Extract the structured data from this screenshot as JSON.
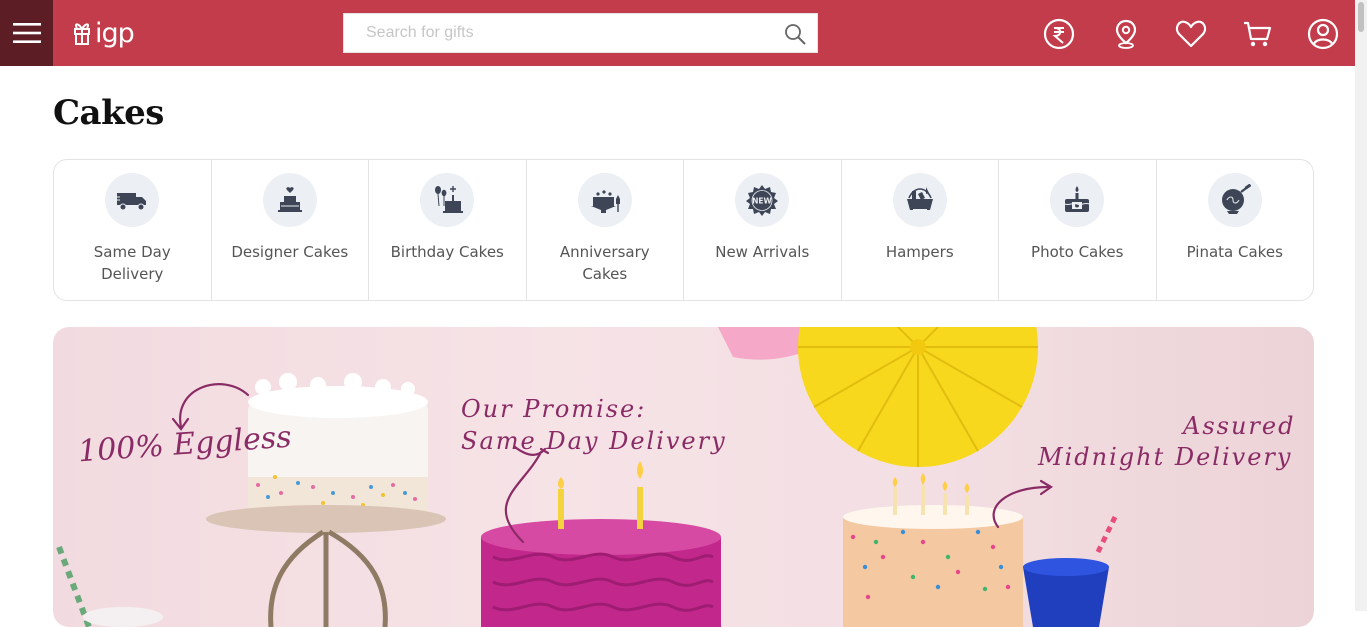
{
  "header": {
    "logo_text": "igp",
    "search_placeholder": "Search for gifts",
    "icons": [
      "rupee-icon",
      "location-icon",
      "heart-icon",
      "cart-icon",
      "user-icon"
    ]
  },
  "page": {
    "title": "Cakes"
  },
  "categories": [
    {
      "label": "Same Day Delivery",
      "icon": "delivery-truck-icon"
    },
    {
      "label": "Designer Cakes",
      "icon": "designer-cake-icon"
    },
    {
      "label": "Birthday Cakes",
      "icon": "birthday-cake-icon"
    },
    {
      "label": "Anniversary Cakes",
      "icon": "anniversary-cake-icon"
    },
    {
      "label": "New Arrivals",
      "icon": "new-badge-icon"
    },
    {
      "label": "Hampers",
      "icon": "hamper-icon"
    },
    {
      "label": "Photo Cakes",
      "icon": "photo-cake-icon"
    },
    {
      "label": "Pinata Cakes",
      "icon": "pinata-cake-icon"
    }
  ],
  "banner": {
    "text_eggless": "100% Eggless",
    "text_promise_line1": "Our Promise:",
    "text_promise_line2": "Same Day Delivery",
    "text_midnight_line1": "Assured",
    "text_midnight_line2": "Midnight Delivery"
  },
  "colors": {
    "header_bg": "#c33c4b",
    "menu_bg": "#5c1e24",
    "banner_text": "#8a2b66"
  }
}
